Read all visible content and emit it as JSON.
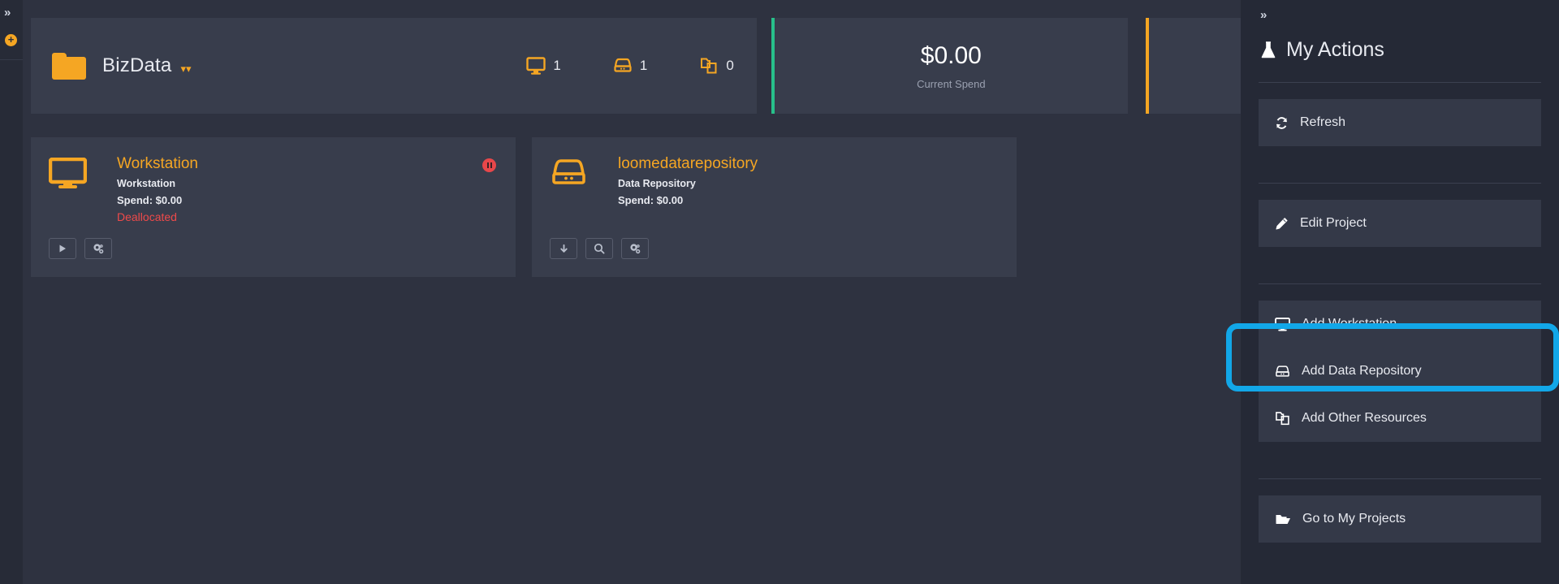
{
  "left_rail": {
    "expand_icon": "double-chevron-right",
    "add_icon": "plus-circle"
  },
  "project_header": {
    "folder_icon": "folder-icon",
    "name": "BizData",
    "caret": "»",
    "stats": [
      {
        "icon": "monitor-icon",
        "label": "workstations",
        "value": "1"
      },
      {
        "icon": "data-repository-icon",
        "label": "data repositories",
        "value": "1"
      },
      {
        "icon": "other-resources-icon",
        "label": "other resources",
        "value": "0"
      }
    ]
  },
  "spend_card": {
    "amount": "$0.00",
    "label": "Current Spend",
    "accent_color": "#27c08a"
  },
  "spend_card_partial": {
    "accent_color": "#f5a623"
  },
  "resources": [
    {
      "icon": "monitor-icon",
      "title": "Workstation",
      "type": "Workstation",
      "spend": "Spend: $0.00",
      "status": "Deallocated",
      "status_color": "#ef4a4a",
      "status_indicator": "paused-icon",
      "buttons": [
        {
          "icon": "play-icon",
          "name": "start-button"
        },
        {
          "icon": "gears-icon",
          "name": "settings-button"
        }
      ]
    },
    {
      "icon": "data-repository-icon",
      "title": "loomedatarepository",
      "type": "Data Repository",
      "spend": "Spend: $0.00",
      "status": "",
      "buttons": [
        {
          "icon": "download-icon",
          "name": "download-button"
        },
        {
          "icon": "search-icon",
          "name": "explore-button"
        },
        {
          "icon": "gears-icon",
          "name": "settings-button"
        }
      ]
    }
  ],
  "right_panel": {
    "collapse_icon": "double-chevron-right",
    "title_icon": "flask-icon",
    "title": "My Actions",
    "groups": [
      {
        "items": [
          {
            "icon": "refresh-icon",
            "label": "Refresh",
            "highlighted": false
          }
        ]
      },
      {
        "items": [
          {
            "icon": "pencil-icon",
            "label": "Edit Project",
            "highlighted": false
          }
        ]
      },
      {
        "items": [
          {
            "icon": "monitor-icon",
            "label": "Add Workstation",
            "highlighted": false
          },
          {
            "icon": "data-repository-icon",
            "label": "Add Data Repository",
            "highlighted": true
          },
          {
            "icon": "other-resources-icon",
            "label": "Add Other Resources",
            "highlighted": false
          }
        ]
      },
      {
        "items": [
          {
            "icon": "folder-open-icon",
            "label": "Go to My Projects",
            "highlighted": false
          }
        ]
      }
    ],
    "highlight_color": "#12a7e8"
  }
}
